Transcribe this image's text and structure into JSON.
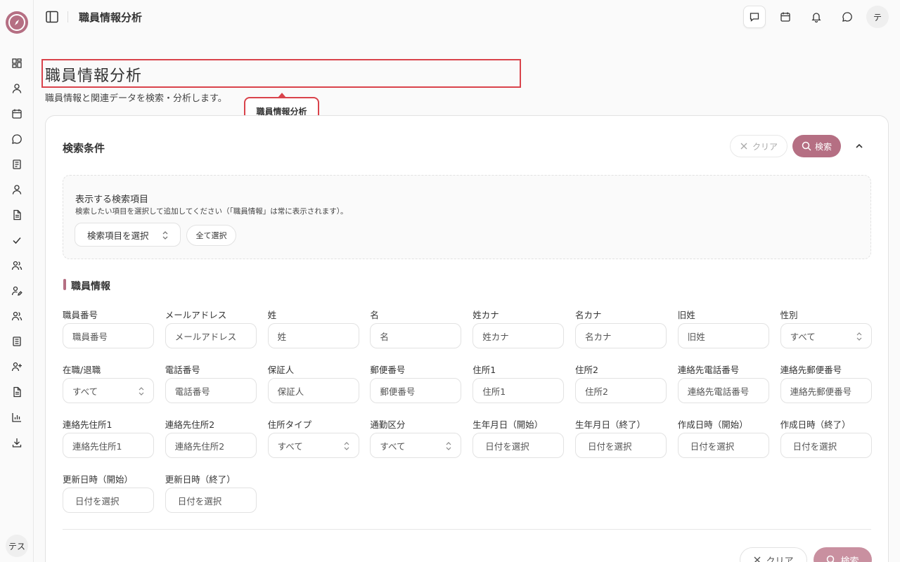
{
  "app": {
    "user_initial_sidebar": "テス",
    "user_initial_top": "テ"
  },
  "colors": {
    "accent": "#b56f83",
    "highlight": "#d9434b"
  },
  "sidebar": {
    "items": [
      {
        "icon": "dashboard-icon"
      },
      {
        "icon": "user-icon"
      },
      {
        "icon": "calendar-icon"
      },
      {
        "icon": "chat-bubble-icon"
      },
      {
        "icon": "notebook-icon"
      },
      {
        "icon": "person-icon"
      },
      {
        "icon": "document-icon"
      },
      {
        "icon": "check-icon"
      },
      {
        "icon": "users-icon"
      },
      {
        "icon": "user-edit-icon"
      },
      {
        "icon": "team-icon"
      },
      {
        "icon": "book-icon"
      },
      {
        "icon": "user-plus-icon"
      },
      {
        "icon": "file-text-icon"
      },
      {
        "icon": "bar-chart-icon"
      },
      {
        "icon": "download-icon"
      }
    ]
  },
  "header": {
    "title": "職員情報分析",
    "buttons": [
      "message-square-icon",
      "calendar-icon",
      "bell-icon",
      "chat-circle-icon"
    ]
  },
  "page": {
    "title": "職員情報分析",
    "description": "職員情報と関連データを検索・分析します。",
    "tooltip": "職員情報分析"
  },
  "search": {
    "title": "検索条件",
    "clear_label": "クリア",
    "search_label": "検索",
    "field_picker": {
      "title": "表示する検索項目",
      "help": "検索したい項目を選択して追加してください（「職員情報」は常に表示されます）。",
      "select_label": "検索項目を選択",
      "select_all_label": "全て選択"
    },
    "section_title": "職員情報",
    "fields": [
      {
        "label": "職員番号",
        "placeholder": "職員番号"
      },
      {
        "label": "メールアドレス",
        "placeholder": "メールアドレス"
      },
      {
        "label": "姓",
        "placeholder": "姓"
      },
      {
        "label": "名",
        "placeholder": "名"
      },
      {
        "label": "姓カナ",
        "placeholder": "姓カナ"
      },
      {
        "label": "名カナ",
        "placeholder": "名カナ"
      },
      {
        "label": "旧姓",
        "placeholder": "旧姓"
      },
      {
        "label": "性別",
        "value": "すべて"
      },
      {
        "label": "在職/退職",
        "value": "すべて"
      },
      {
        "label": "電話番号",
        "placeholder": "電話番号"
      },
      {
        "label": "保証人",
        "placeholder": "保証人"
      },
      {
        "label": "郵便番号",
        "placeholder": "郵便番号"
      },
      {
        "label": "住所1",
        "placeholder": "住所1"
      },
      {
        "label": "住所2",
        "placeholder": "住所2"
      },
      {
        "label": "連絡先電話番号",
        "placeholder": "連絡先電話番号"
      },
      {
        "label": "連絡先郵便番号",
        "placeholder": "連絡先郵便番号"
      },
      {
        "label": "連絡先住所1",
        "placeholder": "連絡先住所1"
      },
      {
        "label": "連絡先住所2",
        "placeholder": "連絡先住所2"
      },
      {
        "label": "住所タイプ",
        "value": "すべて"
      },
      {
        "label": "通勤区分",
        "value": "すべて"
      },
      {
        "label": "生年月日（開始）",
        "placeholder": "日付を選択"
      },
      {
        "label": "生年月日（終了）",
        "placeholder": "日付を選択"
      },
      {
        "label": "作成日時（開始）",
        "placeholder": "日付を選択"
      },
      {
        "label": "作成日時（終了）",
        "placeholder": "日付を選択"
      },
      {
        "label": "更新日時（開始）",
        "placeholder": "日付を選択"
      },
      {
        "label": "更新日時（終了）",
        "placeholder": "日付を選択"
      }
    ]
  }
}
